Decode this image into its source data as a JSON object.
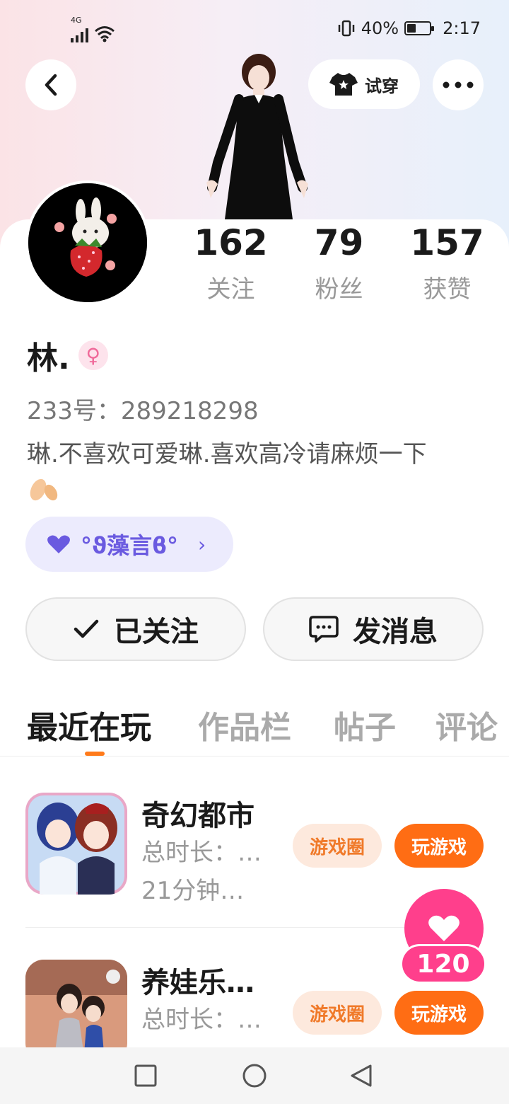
{
  "status_bar": {
    "network": "4G",
    "battery": "40%",
    "time": "2:17"
  },
  "header": {
    "tryon_label": "试穿"
  },
  "stats": [
    {
      "value": "162",
      "label": "关注"
    },
    {
      "value": "79",
      "label": "粉丝"
    },
    {
      "value": "157",
      "label": "获赞"
    }
  ],
  "profile": {
    "name": "林.",
    "uid": "233号：289218298",
    "bio": "琳.不喜欢可爱琳.喜欢高冷请麻烦一下",
    "tag_label": "°ϑ藻言ϐ°"
  },
  "actions": {
    "following_label": "已关注",
    "message_label": "发消息"
  },
  "tabs": [
    "最近在玩",
    "作品栏",
    "帖子",
    "评论"
  ],
  "games": [
    {
      "title": "奇幻都市",
      "meta1": "总时长：…",
      "meta2": "21分钟…",
      "circle_label": "游戏圈",
      "play_label": "玩游戏"
    },
    {
      "title": "养娃乐…",
      "meta1": "总时长：…",
      "meta2": "",
      "circle_label": "游戏圈",
      "play_label": "玩游戏"
    }
  ],
  "like_count": "120",
  "colors": {
    "accent": "#ff6d14",
    "like": "#ff3f8c",
    "tag": "#6a5ae0"
  },
  "icons": [
    "back-icon",
    "tshirt-icon",
    "more-icon",
    "female-icon",
    "heart-icon",
    "chevron-right-icon",
    "check-icon",
    "chat-icon",
    "square-icon",
    "circle-icon",
    "triangle-back-icon"
  ]
}
